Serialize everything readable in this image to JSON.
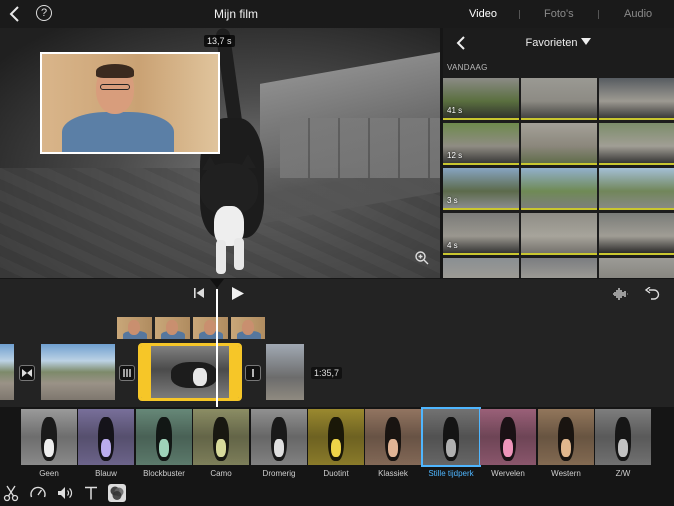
{
  "topbar": {
    "title": "Mijn film",
    "help_label": "?",
    "tabs": [
      {
        "label": "Video",
        "active": true
      },
      {
        "label": "Foto's",
        "active": false
      },
      {
        "label": "Audio",
        "active": false
      }
    ]
  },
  "viewer": {
    "timecode": "13,7 s"
  },
  "browser": {
    "title": "Favorieten",
    "section": "VANDAAG",
    "thumbs": [
      {
        "duration": "41 s",
        "colors": [
          "#8b8b86",
          "#5a6f3f",
          "#2c2c2c"
        ]
      },
      {
        "duration": "",
        "colors": [
          "#9a9993",
          "#8d8b84",
          "#3b3b39"
        ]
      },
      {
        "duration": "",
        "colors": [
          "#575c61",
          "#9d9a92",
          "#2f2f2f"
        ]
      },
      {
        "duration": "12 s",
        "colors": [
          "#6e8a4d",
          "#8f8c83",
          "#303030"
        ]
      },
      {
        "duration": "",
        "colors": [
          "#a4a198",
          "#8b877c",
          "#5c6a45"
        ]
      },
      {
        "duration": "",
        "colors": [
          "#7c8d6a",
          "#a19e95",
          "#2a2a2a"
        ]
      },
      {
        "duration": "3 s",
        "colors": [
          "#87a4c2",
          "#5c6a4b",
          "#8f9096"
        ]
      },
      {
        "duration": "",
        "colors": [
          "#92b0cc",
          "#6f8a55",
          "#7e7e80"
        ]
      },
      {
        "duration": "",
        "colors": [
          "#a4bfd6",
          "#71865a",
          "#8a8a8a"
        ]
      },
      {
        "duration": "4 s",
        "colors": [
          "#7b7b78",
          "#9a978f",
          "#2a2a2a"
        ]
      },
      {
        "duration": "",
        "colors": [
          "#8f8d86",
          "#a7a49b",
          "#6e6c67"
        ]
      },
      {
        "duration": "",
        "colors": [
          "#7a7c78",
          "#a09d95",
          "#1e1e1e"
        ]
      },
      {
        "duration": "",
        "colors": [
          "#8a8f93",
          "#9f9c94",
          "#444444"
        ]
      },
      {
        "duration": "",
        "colors": [
          "#7b7d80",
          "#a09e97",
          "#4a4a4a"
        ]
      },
      {
        "duration": "",
        "colors": [
          "#9c9b96",
          "#85837d",
          "#555555"
        ]
      }
    ],
    "accent_bar": "#c9c62f"
  },
  "timeline": {
    "duration_label": "1:35,7",
    "selection_color": "#f6c628"
  },
  "filters": {
    "items": [
      {
        "label": "Geen",
        "tint": "#ffffff",
        "selected": false
      },
      {
        "label": "Blauw",
        "tint": "#c7b8ff",
        "selected": false
      },
      {
        "label": "Blockbuster",
        "tint": "#a9e1c6",
        "selected": false
      },
      {
        "label": "Camo",
        "tint": "#e7eaa6",
        "selected": false
      },
      {
        "label": "Dromerig",
        "tint": "#efefef",
        "selected": false
      },
      {
        "label": "Duotint",
        "tint": "#ffe34d",
        "selected": false
      },
      {
        "label": "Klassiek",
        "tint": "#f2c1a0",
        "selected": false
      },
      {
        "label": "Stille tijdperk",
        "tint": "#bdbdbd",
        "selected": true
      },
      {
        "label": "Wervelen",
        "tint": "#ff9fc7",
        "selected": false
      },
      {
        "label": "Western",
        "tint": "#f2c497",
        "selected": false
      },
      {
        "label": "Z/W",
        "tint": "#d0d0d0",
        "selected": false
      }
    ],
    "selected_color": "#4fb6ff"
  },
  "tools": [
    {
      "icon": "scissors-icon",
      "active": false
    },
    {
      "icon": "speed-icon",
      "active": false
    },
    {
      "icon": "volume-icon",
      "active": false
    },
    {
      "icon": "title-text-icon",
      "active": false
    },
    {
      "icon": "filter-icon",
      "active": true
    }
  ]
}
